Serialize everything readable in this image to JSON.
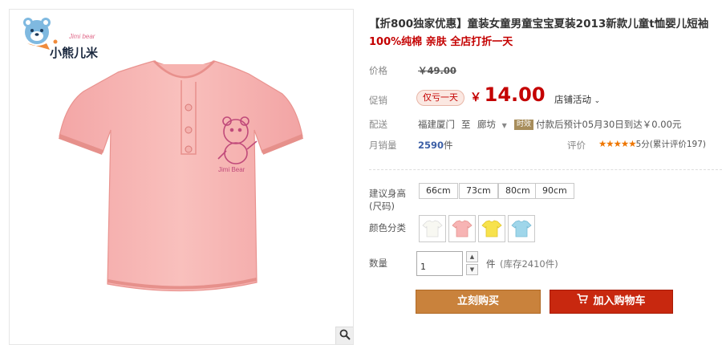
{
  "product": {
    "title": "【折800独家优惠】童装女童男童宝宝夏装2013新款儿童t恤婴儿短袖",
    "subtitle": "100%纯棉 亲肤 全店打折一天"
  },
  "brand": {
    "logo_text": "小熊儿米",
    "logo_tagline": "Jimi bear"
  },
  "price": {
    "label": "价格",
    "original": "￥49.00"
  },
  "promo": {
    "label": "促销",
    "tag": "仅亏一天",
    "currency": "￥",
    "price": "14.00",
    "activity": "店铺活动"
  },
  "shipping": {
    "label": "配送",
    "from": "福建厦门",
    "to_word": "至",
    "to": "廊坊",
    "badge": "时效",
    "text": "付款后预计05月30日到达￥0.00元"
  },
  "sales": {
    "label": "月销量",
    "count": "2590",
    "unit": "件",
    "review_label": "评价",
    "stars": "★★★★★",
    "review_text": "5分(累计评价197)"
  },
  "size": {
    "label": "建议身高(尺码)",
    "options": [
      "66cm",
      "73cm",
      "80cm",
      "90cm"
    ]
  },
  "color": {
    "label": "颜色分类"
  },
  "quantity": {
    "label": "数量",
    "value": "1",
    "unit": "件",
    "stock": "(库存2410件)"
  },
  "actions": {
    "buy": "立刻购买",
    "cart": "加入购物车"
  },
  "colors": {
    "accent_red": "#c40000",
    "buy_button": "#c9823c",
    "cart_button": "#c8280f"
  }
}
